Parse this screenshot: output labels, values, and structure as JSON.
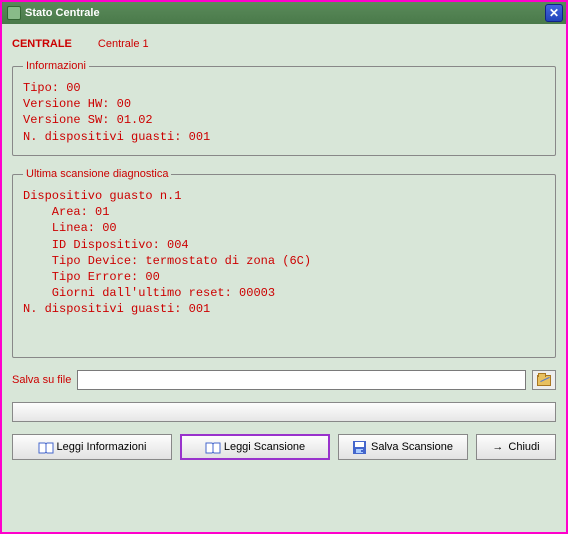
{
  "window": {
    "title": "Stato Centrale"
  },
  "header": {
    "centrale_label": "CENTRALE",
    "centrale_name": "Centrale 1"
  },
  "info": {
    "legend": "Informazioni",
    "line1": "Tipo: 00",
    "line2": "Versione HW: 00",
    "line3": "Versione SW: 01.02",
    "line4": "N. dispositivi guasti: 001"
  },
  "scan": {
    "legend": "Ultima scansione diagnostica",
    "line1": "Dispositivo guasto n.1",
    "line2": "    Area: 01",
    "line3": "    Linea: 00",
    "line4": "    ID Dispositivo: 004",
    "line5": "    Tipo Device: termostato di zona (6C)",
    "line6": "    Tipo Errore: 00",
    "line7": "    Giorni dall'ultimo reset: 00003",
    "line8": "N. dispositivi guasti: 001"
  },
  "save": {
    "label": "Salva su file",
    "path": ""
  },
  "buttons": {
    "leggi_info": "Leggi Informazioni",
    "leggi_scan": "Leggi Scansione",
    "salva_scan": "Salva Scansione",
    "chiudi": "Chiudi"
  }
}
